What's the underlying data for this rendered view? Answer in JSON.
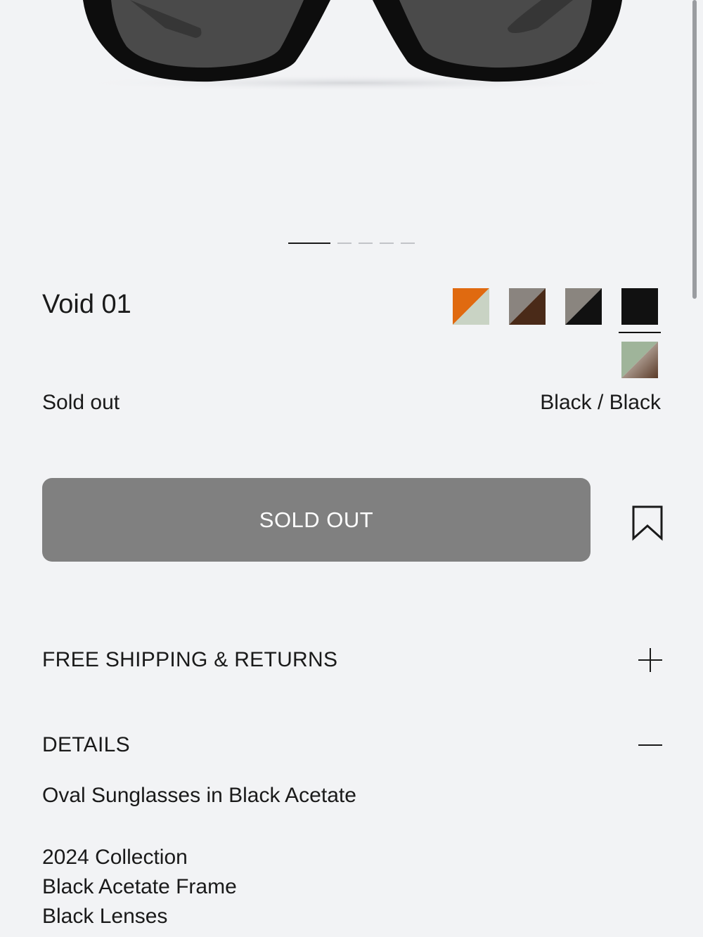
{
  "product": {
    "name": "Void 01",
    "status": "Sold out",
    "selected_color": "Black / Black"
  },
  "gallery": {
    "slides": 5,
    "active_index": 0
  },
  "swatches": [
    {
      "name": "orange-swatch",
      "top": "#e06a10",
      "bottom": "#c9d3c4"
    },
    {
      "name": "grey-brown-swatch",
      "top": "#8a847f",
      "bottom": "#4a2a18"
    },
    {
      "name": "grey-black-swatch",
      "top": "#8a857f",
      "bottom": "#111111"
    },
    {
      "name": "black-swatch",
      "top": "#111111",
      "bottom": "#111111",
      "selected": true
    },
    {
      "name": "sage-brown-swatch",
      "top": "#9fb49a",
      "bottom": "#5a3a28"
    }
  ],
  "actions": {
    "sold_out_label": "SOLD OUT",
    "bookmark_icon": "bookmark-icon"
  },
  "accordions": {
    "shipping_label": "FREE SHIPPING & RETURNS",
    "details_label": "DETAILS"
  },
  "details": {
    "description": "Oval Sunglasses in Black Acetate",
    "lines": [
      "2024 Collection",
      "Black Acetate Frame",
      "Black Lenses"
    ]
  },
  "colors": {
    "background": "#f2f3f5",
    "button": "#808080",
    "text": "#1a1a1a"
  }
}
